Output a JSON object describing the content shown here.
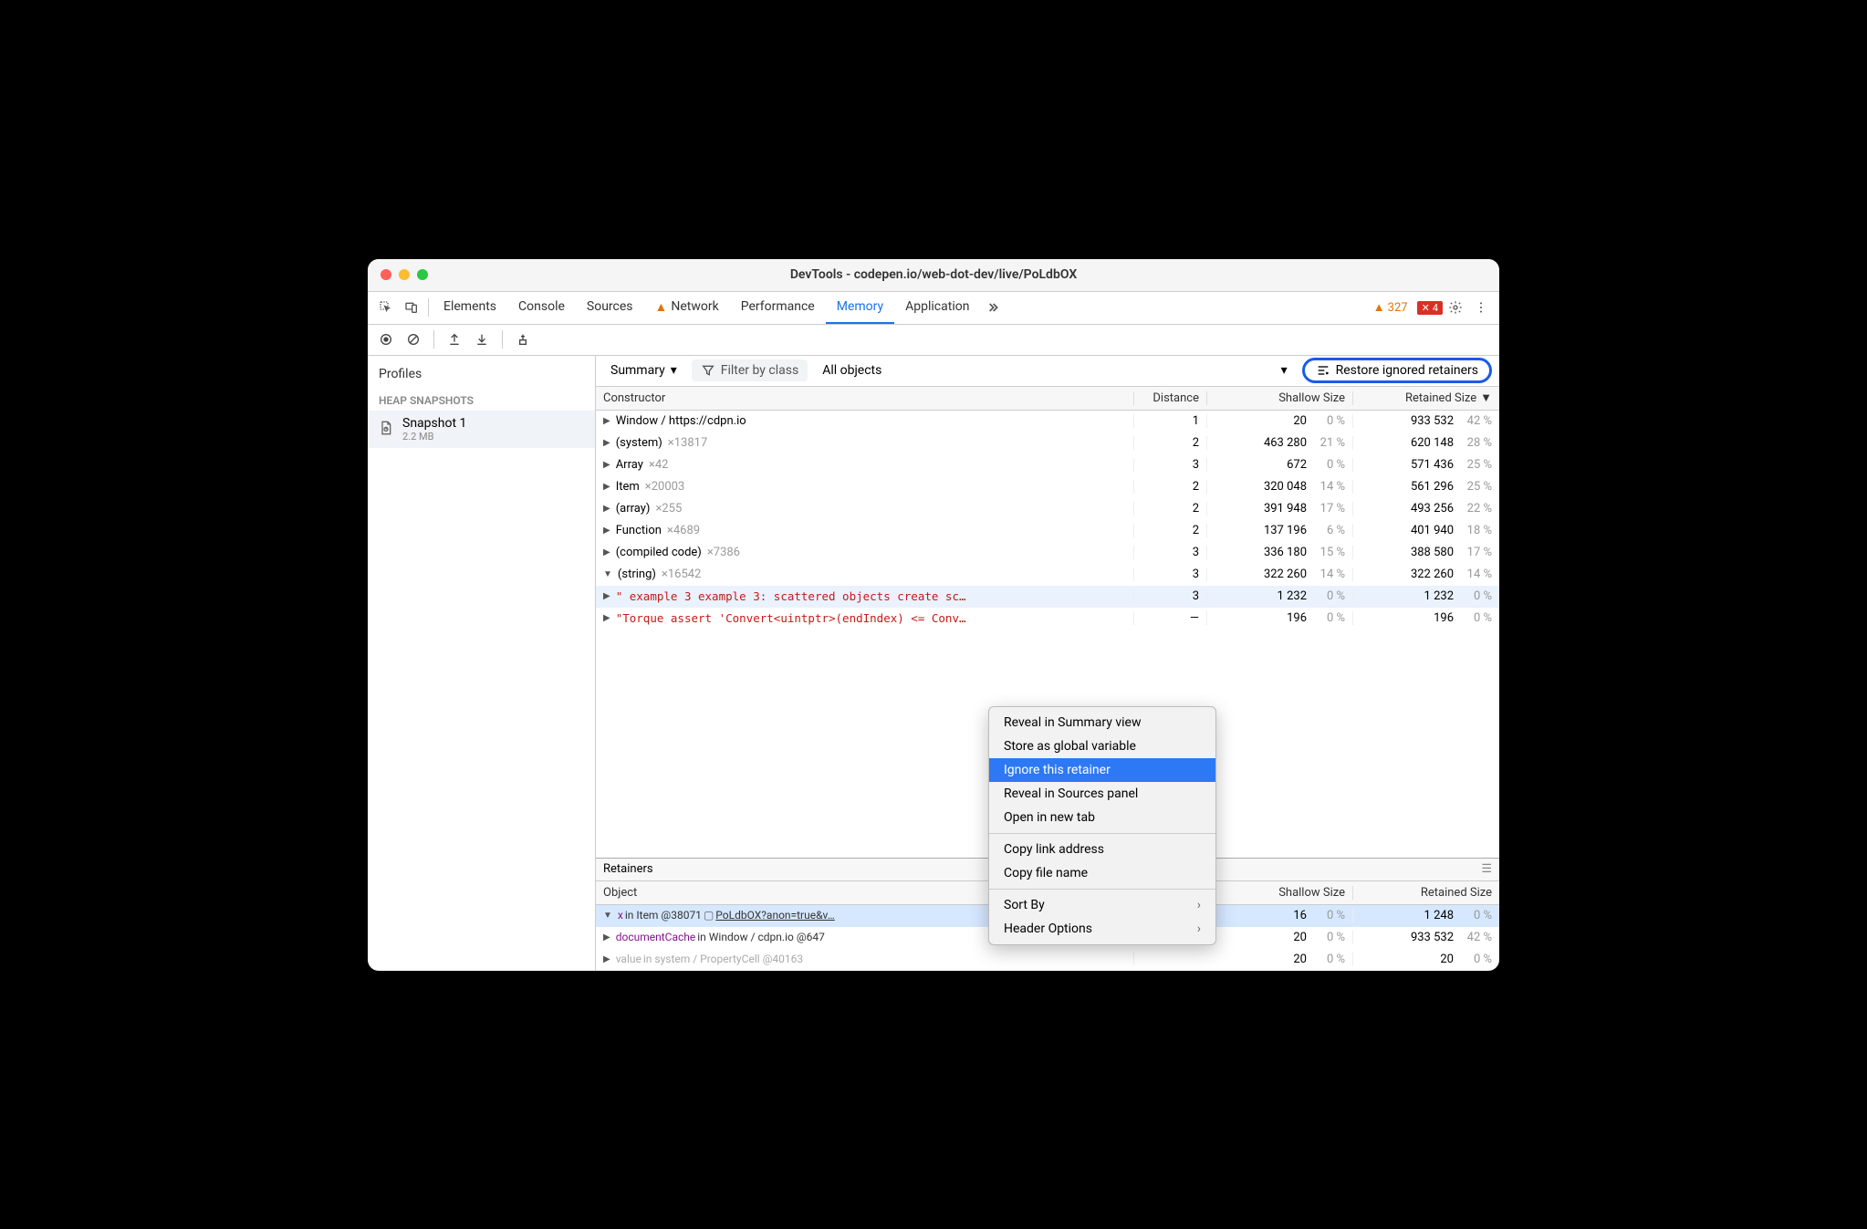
{
  "titlebar": {
    "title": "DevTools - codepen.io/web-dot-dev/live/PoLdbOX"
  },
  "tabs": {
    "elements": "Elements",
    "console": "Console",
    "sources": "Sources",
    "network": "Network",
    "performance": "Performance",
    "memory": "Memory",
    "application": "Application"
  },
  "badges": {
    "warn": "327",
    "err": "4"
  },
  "sidebar": {
    "profiles": "Profiles",
    "heap_snapshots": "HEAP SNAPSHOTS",
    "snapshot_name": "Snapshot 1",
    "snapshot_size": "2.2 MB"
  },
  "subbar": {
    "summary": "Summary",
    "filter_placeholder": "Filter by class",
    "all_objects": "All objects",
    "restore": "Restore ignored retainers"
  },
  "headers": {
    "constructor": "Constructor",
    "object": "Object",
    "distance": "Distance",
    "shallow": "Shallow Size",
    "retained": "Retained Size"
  },
  "rows": [
    {
      "name": "Window / https://cdpn.io",
      "count": "",
      "dist": "1",
      "shallow": "20",
      "sp": "0 %",
      "ret": "933 532",
      "rp": "42 %"
    },
    {
      "name": "(system)",
      "count": "×13817",
      "dist": "2",
      "shallow": "463 280",
      "sp": "21 %",
      "ret": "620 148",
      "rp": "28 %"
    },
    {
      "name": "Array",
      "count": "×42",
      "dist": "3",
      "shallow": "672",
      "sp": "0 %",
      "ret": "571 436",
      "rp": "25 %"
    },
    {
      "name": "Item",
      "count": "×20003",
      "dist": "2",
      "shallow": "320 048",
      "sp": "14 %",
      "ret": "561 296",
      "rp": "25 %"
    },
    {
      "name": "(array)",
      "count": "×255",
      "dist": "2",
      "shallow": "391 948",
      "sp": "17 %",
      "ret": "493 256",
      "rp": "22 %"
    },
    {
      "name": "Function",
      "count": "×4689",
      "dist": "2",
      "shallow": "137 196",
      "sp": "6 %",
      "ret": "401 940",
      "rp": "18 %"
    },
    {
      "name": "(compiled code)",
      "count": "×7386",
      "dist": "3",
      "shallow": "336 180",
      "sp": "15 %",
      "ret": "388 580",
      "rp": "17 %"
    },
    {
      "name": "(string)",
      "count": "×16542",
      "dist": "3",
      "shallow": "322 260",
      "sp": "14 %",
      "ret": "322 260",
      "rp": "14 %",
      "open": true
    },
    {
      "indent": true,
      "str": "\" example 3 example 3: scattered objects create sc…",
      "dist": "3",
      "shallow": "1 232",
      "sp": "0 %",
      "ret": "1 232",
      "rp": "0 %",
      "sel": true
    },
    {
      "indent": true,
      "str": "\"Torque assert 'Convert<uintptr>(endIndex) <= Conv…",
      "dist": "—",
      "shallow": "196",
      "sp": "0 %",
      "ret": "196",
      "rp": "0 %"
    }
  ],
  "retainers": {
    "title": "Retainers"
  },
  "retrows": [
    {
      "prop": "x",
      "mid": " in Item @38071 ",
      "link": "PoLdbOX?anon=true&v…",
      "dist": "",
      "shallow": "16",
      "sp": "0 %",
      "ret": "1 248",
      "rp": "0 %",
      "open": true,
      "sel": true
    },
    {
      "prop": "documentCache",
      "mid": " in Window / cdpn.io @647",
      "dist": "",
      "shallow": "20",
      "sp": "0 %",
      "ret": "933 532",
      "rp": "42 %"
    },
    {
      "prop": "value",
      "mid": " in system / PropertyCell @40163",
      "dist": "",
      "shallow": "20",
      "sp": "0 %",
      "ret": "20",
      "rp": "0 %",
      "dim": true
    }
  ],
  "menu": {
    "reveal_summary": "Reveal in Summary view",
    "store_global": "Store as global variable",
    "ignore_retainer": "Ignore this retainer",
    "reveal_sources": "Reveal in Sources panel",
    "open_tab": "Open in new tab",
    "copy_link": "Copy link address",
    "copy_file": "Copy file name",
    "sort_by": "Sort By",
    "header_opts": "Header Options"
  }
}
